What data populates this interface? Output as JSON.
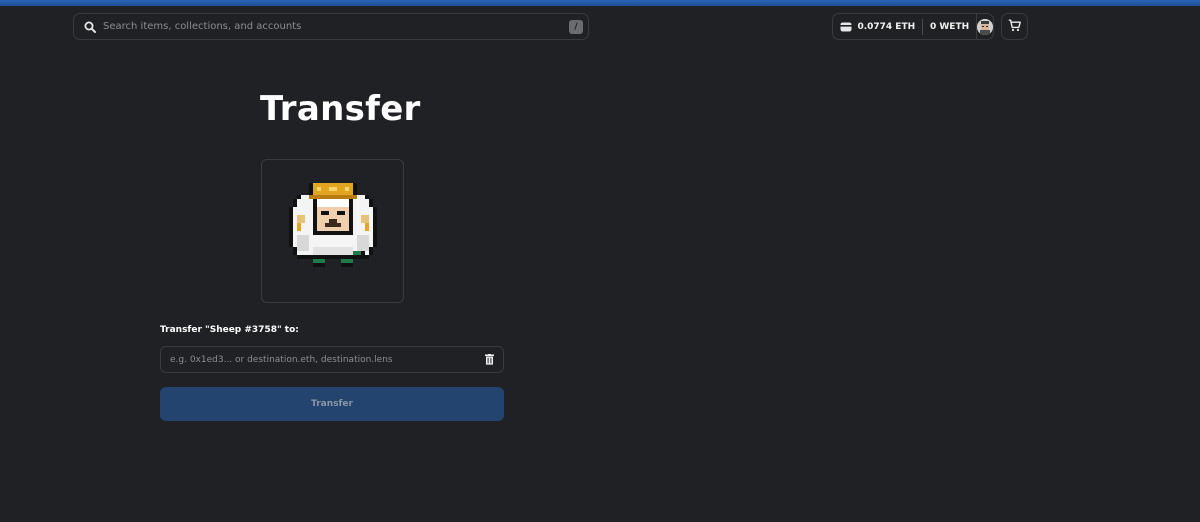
{
  "header": {
    "search": {
      "placeholder": "Search items, collections, and accounts",
      "shortcut": "/"
    },
    "wallet": {
      "eth_balance": "0.0774 ETH",
      "weth_balance": "0 WETH"
    }
  },
  "main": {
    "title": "Transfer",
    "transfer_label": "Transfer \"Sheep #3758\" to:",
    "destination": {
      "placeholder": "e.g. 0x1ed3... or destination.eth, destination.lens",
      "value": ""
    },
    "transfer_button": "Transfer"
  },
  "icons": [
    "search-icon",
    "wallet-icon",
    "avatar",
    "cart-icon",
    "nft-image",
    "trash-icon"
  ],
  "colors": {
    "background": "#202124",
    "accent_stripe": "#2a64b8",
    "button_disabled": "#22446e",
    "border": "#3a3b3f"
  }
}
